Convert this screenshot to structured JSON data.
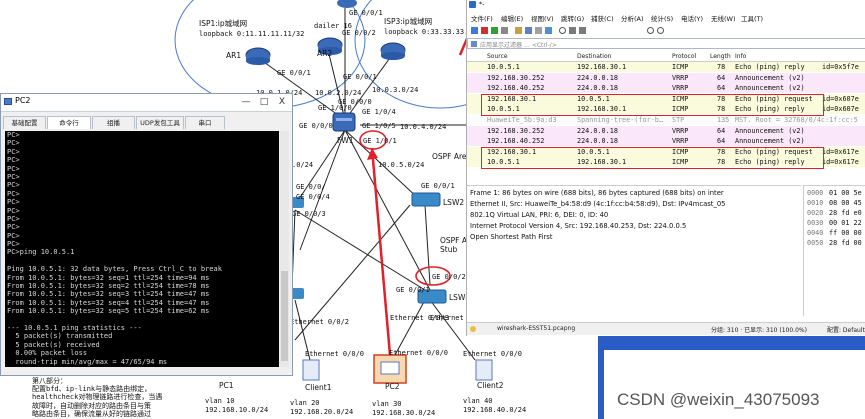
{
  "topology": {
    "isp1": {
      "title": "ISP1:ip城域网",
      "loopback": "loopback 0:11.11.11.11/32"
    },
    "isp3": {
      "title": "ISP3:ip城域网",
      "loopback": "loopback 0:33.33.33.33/32"
    },
    "dailer_label": "dailer 16",
    "devices": {
      "ar1": "AR1",
      "ar2": "AR2",
      "fw1": "FW1",
      "lsw2": "LSW2",
      "lsw4": "LSW4",
      "pc1": "PC1",
      "client1": "Client1",
      "pc2": "PC2",
      "client2": "Client2"
    },
    "ports": {
      "ar1_ge": "GE 0/0/1",
      "ar2_ge01": "GE 0/0/1",
      "ar2_ge02": "GE 0/0/2",
      "ar2_ge00": "GE 0/0/0",
      "ar_top_ge01": "GE 0/0/1",
      "ar_top_ge02": "GE 0/0/2",
      "fw_ge10": "GE 1/0/0",
      "fw_ge13": "GE 1/0/3",
      "fw_ge14": "GE 1/0/4",
      "fw_ge00": "GE 0/0/0",
      "fw_ge15": "GE 1/0/5",
      "fw_ge11": "GE 1/0/1",
      "fw_ge21": "GE 1/0/1",
      "lsw2_ge04": "GE 0/0/4",
      "lsw2_ge03": "GE 0/0/3",
      "lsw2_ge0": "GE 0/0/",
      "lsw2_ge01": "GE 0/0/1",
      "lsw4_ge02": "GE 0/0/2",
      "lsw4_ge01": "GE 0/0/1",
      "eth_002": "Ethernet 0/0/2",
      "eth_003": "Ethernet 0/0/3",
      "eth_004": "Ethernet 0/0/4",
      "eth_c1": "Ethernet 0/0/0",
      "eth_pc2": "Ethernet 0/0/0",
      "eth_c2": "Ethernet 0/0/0"
    },
    "subnets": {
      "s1": "10.0.1.0/24",
      "s2": "10.0.2.0/24",
      "s3": "10.0.3.0/24",
      "s4": "10.0.4.0/24",
      "s5": "10.0.5.0/24"
    },
    "ospf_area": "OSPF Are",
    "ospf_stub": {
      "l1": "OSPF Ar",
      "l2": "Stub"
    },
    "partial_left": ".0/24",
    "vlans": [
      {
        "vlan": "vlan 10",
        "net": "192.168.10.0/24"
      },
      {
        "vlan": "vlan 20",
        "net": "192.168.20.0/24"
      },
      {
        "vlan": "vlan 30",
        "net": "192.168.30.0/24"
      },
      {
        "vlan": "vlan 40",
        "net": "192.168.40.0/24"
      }
    ],
    "note": {
      "lines": [
        "第八部分：",
        "配置bfd、ip-link与静态路由绑定，",
        "healthcheck对物理链路进行检查，当遇",
        "故障时，自动删除对应的路由条目与策",
        "略路由条目，确保流量从好的链路通过"
      ]
    }
  },
  "pc2_window": {
    "title": "PC2",
    "controls": {
      "minimize": "—",
      "maximize": "□",
      "close": "X"
    },
    "tabs": [
      "基础配置",
      "命令行",
      "组播",
      "UDP发包工具",
      "串口"
    ],
    "console_lines": [
      "PC>",
      "PC>",
      "PC>",
      "PC>",
      "PC>",
      "PC>",
      "PC>",
      "PC>",
      "PC>",
      "PC>",
      "PC>",
      "PC>",
      "PC>",
      "PC>",
      "PC>ping 10.0.5.1",
      "",
      "Ping 10.0.5.1: 32 data bytes, Press Ctrl_C to break",
      "From 10.0.5.1: bytes=32 seq=1 ttl=254 time=94 ms",
      "From 10.0.5.1: bytes=32 seq=2 ttl=254 time=78 ms",
      "From 10.0.5.1: bytes=32 seq=3 ttl=254 time=47 ms",
      "From 10.0.5.1: bytes=32 seq=4 ttl=254 time=47 ms",
      "From 10.0.5.1: bytes=32 seq=5 ttl=254 time=62 ms",
      "",
      "--- 10.0.5.1 ping statistics ---",
      "  5 packet(s) transmitted",
      "  5 packet(s) received",
      "  0.00% packet loss",
      "  round-trip min/avg/max = 47/65/94 ms",
      "",
      "PC>"
    ]
  },
  "wireshark": {
    "title": "*-",
    "menu": [
      "文件(F)",
      "编辑(E)",
      "视图(V)",
      "跳转(G)",
      "捕获(C)",
      "分析(A)",
      "统计(S)",
      "电话(Y)",
      "无线(W)",
      "工具(T)"
    ],
    "filter_placeholder": "应用显示过滤器 … <Ctrl-/>",
    "columns": {
      "source": "Source",
      "destination": "Destination",
      "protocol": "Protocol",
      "length": "Length",
      "info": "Info"
    },
    "rows": [
      {
        "src": "10.0.5.1",
        "dst": "192.168.30.1",
        "proto": "ICMP",
        "len": "78",
        "info": "Echo (ping) reply",
        "extra": "id=0x5f7e"
      },
      {
        "src": "192.168.30.252",
        "dst": "224.0.0.18",
        "proto": "VRRP",
        "len": "64",
        "info": "Announcement (v2)",
        "extra": ""
      },
      {
        "src": "192.168.40.252",
        "dst": "224.0.0.18",
        "proto": "VRRP",
        "len": "64",
        "info": "Announcement (v2)",
        "extra": ""
      },
      {
        "src": "192.168.30.1",
        "dst": "10.0.5.1",
        "proto": "ICMP",
        "len": "78",
        "info": "Echo (ping) request",
        "extra": "id=0x607e"
      },
      {
        "src": "10.0.5.1",
        "dst": "192.168.30.1",
        "proto": "ICMP",
        "len": "78",
        "info": "Echo (ping) reply",
        "extra": "id=0x607e"
      },
      {
        "src": "HuaweiTe_5b:9a:d3",
        "dst": "Spanning-tree-(for-b…",
        "proto": "STP",
        "len": "135",
        "info": "MST. Root = 32768/0/4c:1f:cc:5",
        "extra": ""
      },
      {
        "src": "192.168.30.252",
        "dst": "224.0.0.18",
        "proto": "VRRP",
        "len": "64",
        "info": "Announcement (v2)",
        "extra": ""
      },
      {
        "src": "192.168.40.252",
        "dst": "224.0.0.18",
        "proto": "VRRP",
        "len": "64",
        "info": "Announcement (v2)",
        "extra": ""
      },
      {
        "src": "192.168.30.1",
        "dst": "10.0.5.1",
        "proto": "ICMP",
        "len": "78",
        "info": "Echo (ping) request",
        "extra": "id=0x617e"
      },
      {
        "src": "10.0.5.1",
        "dst": "192.168.30.1",
        "proto": "ICMP",
        "len": "78",
        "info": "Echo (ping) reply",
        "extra": "id=0x617e"
      }
    ],
    "details": [
      "Frame 1: 86 bytes on wire (688 bits), 86 bytes captured (688 bits) on inter",
      "Ethernet II, Src: HuaweiTe_b4:58:d9 (4c:1f:cc:b4:58:d9), Dst: IPv4mcast_05",
      "802.1Q Virtual LAN, PRI: 6, DEI: 0, ID: 40",
      "Internet Protocol Version 4, Src: 192.168.40.253, Dst: 224.0.0.5",
      "Open Shortest Path First"
    ],
    "hex": [
      {
        "off": "0000",
        "bytes": "01 00 5e"
      },
      {
        "off": "0010",
        "bytes": "08 00 45"
      },
      {
        "off": "0020",
        "bytes": "28 fd e0"
      },
      {
        "off": "0030",
        "bytes": "00 01 22"
      },
      {
        "off": "0040",
        "bytes": "ff 00 00"
      },
      {
        "off": "0050",
        "bytes": "28 fd 00"
      }
    ],
    "status": {
      "file": "wireshark-ESST51.pcapng",
      "counts": "分组: 310 · 已显示: 310 (100.0%)",
      "profile": "配置: Default"
    },
    "colors": {
      "vrrp_row": "#fae8fa",
      "icmp_row": "#fafadc",
      "stp_row": "#fcfcfc",
      "highlight": "#e0202a"
    }
  },
  "watermark": "CSDN @weixin_43075093"
}
